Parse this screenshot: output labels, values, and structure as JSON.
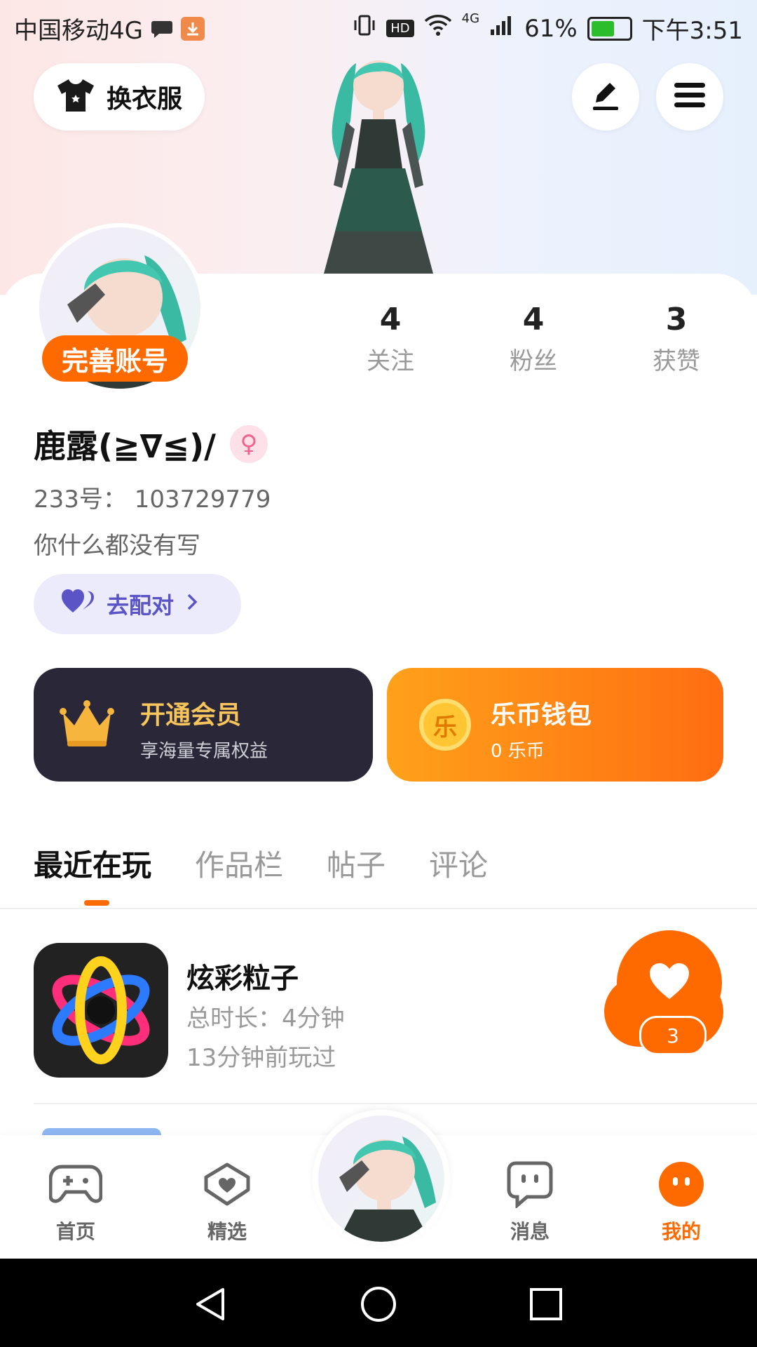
{
  "status_bar": {
    "carrier": "中国移动4G",
    "battery_percent": "61%",
    "time": "下午3:51",
    "hd_label": "HD",
    "network_label": "4G",
    "battery_level": 0.61
  },
  "header": {
    "wardrobe_label": "换衣服"
  },
  "profile": {
    "complete_badge": "完善账号",
    "stats": [
      {
        "value": "4",
        "label": "关注"
      },
      {
        "value": "4",
        "label": "粉丝"
      },
      {
        "value": "3",
        "label": "获赞"
      }
    ],
    "name": "鹿露(≧∇≦)/",
    "uid": "233号：  103729779",
    "bio": "你什么都没有写",
    "pair_label": "去配对"
  },
  "promos": {
    "vip": {
      "title": "开通会员",
      "subtitle": "享海量专属权益"
    },
    "wallet": {
      "title": "乐币钱包",
      "subtitle": "0 乐币",
      "coin_glyph": "乐"
    }
  },
  "tabs": [
    {
      "label": "最近在玩",
      "active": true
    },
    {
      "label": "作品栏",
      "active": false
    },
    {
      "label": "帖子",
      "active": false
    },
    {
      "label": "评论",
      "active": false
    }
  ],
  "recent_games": [
    {
      "name": "炫彩粒子",
      "duration": "总时长：4分钟",
      "last_played": "13分钟前玩过",
      "like_count": "3"
    }
  ],
  "bottom_nav": [
    {
      "label": "首页",
      "icon": "gamepad-icon"
    },
    {
      "label": "精选",
      "icon": "heart-outline-icon"
    },
    {
      "label": "消息",
      "icon": "chat-icon"
    },
    {
      "label": "我的",
      "icon": "face-icon",
      "active": true
    }
  ],
  "colors": {
    "accent": "#ff6a00",
    "pair_text": "#5a54c7",
    "vip_bg": "#2a2838",
    "vip_title": "#f7c55b"
  }
}
